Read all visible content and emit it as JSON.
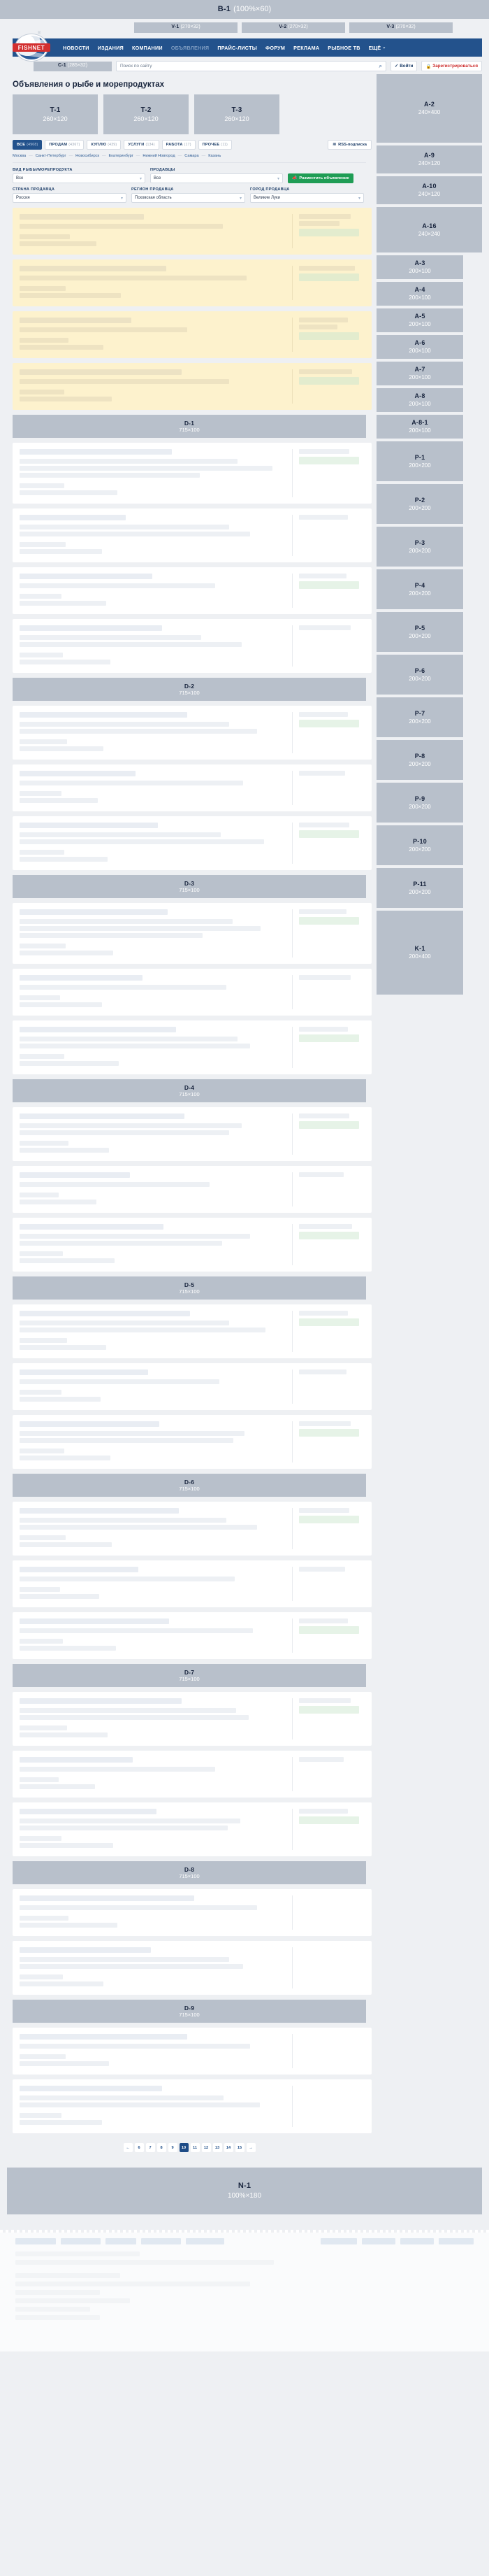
{
  "top_banner": {
    "code": "B-1",
    "dim": "(100%×60)"
  },
  "v_banners": [
    {
      "code": "V-1",
      "dim": "(270×32)"
    },
    {
      "code": "V-2",
      "dim": "(270×32)"
    },
    {
      "code": "V-3",
      "dim": "(270×32)"
    }
  ],
  "logo": {
    "text": "FISHNET",
    "reg": "®"
  },
  "nav": {
    "items": [
      {
        "label": "НОВОСТИ",
        "dim": false
      },
      {
        "label": "ИЗДАНИЯ",
        "dim": false
      },
      {
        "label": "КОМПАНИИ",
        "dim": false
      },
      {
        "label": "ОБЪЯВЛЕНИЯ",
        "dim": true
      },
      {
        "label": "ПРАЙС-ЛИСТЫ",
        "dim": false
      },
      {
        "label": "ФОРУМ",
        "dim": false
      },
      {
        "label": "РЕКЛАМА",
        "dim": false
      },
      {
        "label": "РЫБНОЕ ТВ",
        "dim": false
      },
      {
        "label": "ЕЩЁ",
        "dim": false
      }
    ],
    "more_caret": "▾"
  },
  "search": {
    "c1_code": "C-1",
    "c1_dim": "(285×32)",
    "placeholder": "Поиск по сайту",
    "value": "",
    "search_icon": "⌕",
    "login_label": "Войти",
    "login_icon": "✓",
    "register_label": "Зарегистрироваться",
    "register_icon": "🔒"
  },
  "page_title": "Объявления о рыбе и морепродуктах",
  "t_banners": [
    {
      "code": "T-1",
      "dim": "260×120"
    },
    {
      "code": "T-2",
      "dim": "260×120"
    },
    {
      "code": "T-3",
      "dim": "260×120"
    }
  ],
  "tabs": [
    {
      "label": "ВСЕ",
      "count": "(4968)",
      "active": true
    },
    {
      "label": "ПРОДАМ",
      "count": "(4367)",
      "active": false
    },
    {
      "label": "КУПЛЮ",
      "count": "(439)",
      "active": false
    },
    {
      "label": "УСЛУГИ",
      "count": "(134)",
      "active": false
    },
    {
      "label": "РАБОТА",
      "count": "(17)",
      "active": false
    },
    {
      "label": "ПРОЧЕЕ",
      "count": "(11)",
      "active": false
    }
  ],
  "rss": {
    "label": "RSS-подписка",
    "icon": "≋"
  },
  "cities": [
    "Москва",
    "Санкт-Петербург",
    "Новосибирск",
    "Екатеринбург",
    "Нижний Новгород",
    "Самара",
    "Казань"
  ],
  "city_separator": "—",
  "filters": {
    "row1": [
      {
        "label": "ВИД РЫБЫ/МОРЕПРОДУКТА",
        "value": "Все",
        "width": "w190"
      },
      {
        "label": "ПРОДАВЦЫ",
        "value": "Все",
        "width": "w190"
      }
    ],
    "post_button": {
      "label": "Разместить объявление",
      "icon": "📣"
    },
    "row2": [
      {
        "label": "СТРАНА ПРОДАВЦА",
        "value": "Россия",
        "width": "w163"
      },
      {
        "label": "РЕГИОН ПРОДАВЦА",
        "value": "Псковская область",
        "width": "w163"
      },
      {
        "label": "ГОРОД ПРОДАВЦА",
        "value": "Великие Луки",
        "width": "w163"
      }
    ],
    "chevron": "▾"
  },
  "d_banners": [
    {
      "code": "D-1",
      "dim": "715×100"
    },
    {
      "code": "D-2",
      "dim": "715×100"
    },
    {
      "code": "D-3",
      "dim": "715×100"
    },
    {
      "code": "D-4",
      "dim": "715×100"
    },
    {
      "code": "D-5",
      "dim": "715×100"
    },
    {
      "code": "D-6",
      "dim": "715×100"
    },
    {
      "code": "D-7",
      "dim": "715×100"
    },
    {
      "code": "D-8",
      "dim": "715×100"
    },
    {
      "code": "D-9",
      "dim": "715×100"
    }
  ],
  "rail": [
    {
      "code": "A-2",
      "dim": "240×400",
      "size": "h-a2"
    },
    {
      "code": "A-9",
      "dim": "240×120",
      "size": "h-120"
    },
    {
      "code": "A-10",
      "dim": "240×120",
      "size": "h-120"
    },
    {
      "code": "A-16",
      "dim": "240×240",
      "size": "h-a16"
    },
    {
      "code": "A-3",
      "dim": "200×100",
      "size": "h-100"
    },
    {
      "code": "A-4",
      "dim": "200×100",
      "size": "h-100"
    },
    {
      "code": "A-5",
      "dim": "200×100",
      "size": "h-100"
    },
    {
      "code": "A-6",
      "dim": "200×100",
      "size": "h-100"
    },
    {
      "code": "A-7",
      "dim": "200×100",
      "size": "h-100"
    },
    {
      "code": "A-8",
      "dim": "200×100",
      "size": "h-100"
    },
    {
      "code": "A-8-1",
      "dim": "200×100",
      "size": "h-100"
    },
    {
      "code": "P-1",
      "dim": "200×200",
      "size": "h-200"
    },
    {
      "code": "P-2",
      "dim": "200×200",
      "size": "h-200"
    },
    {
      "code": "P-3",
      "dim": "200×200",
      "size": "h-200"
    },
    {
      "code": "P-4",
      "dim": "200×200",
      "size": "h-200"
    },
    {
      "code": "P-5",
      "dim": "200×200",
      "size": "h-200"
    },
    {
      "code": "P-6",
      "dim": "200×200",
      "size": "h-200"
    },
    {
      "code": "P-7",
      "dim": "200×200",
      "size": "h-200"
    },
    {
      "code": "P-8",
      "dim": "200×200",
      "size": "h-200"
    },
    {
      "code": "P-9",
      "dim": "200×200",
      "size": "h-200"
    },
    {
      "code": "P-10",
      "dim": "200×200",
      "size": "h-200"
    },
    {
      "code": "P-11",
      "dim": "200×200",
      "size": "h-200"
    },
    {
      "code": "K-1",
      "dim": "200×400",
      "size": "h-k1"
    }
  ],
  "pagination": {
    "prev": "←",
    "next": "→",
    "pages": [
      "6",
      "7",
      "8",
      "9",
      "10",
      "11",
      "12",
      "13",
      "14",
      "15"
    ],
    "current": "10"
  },
  "bottom_banner": {
    "code": "N-1",
    "dim": "100%×180"
  }
}
